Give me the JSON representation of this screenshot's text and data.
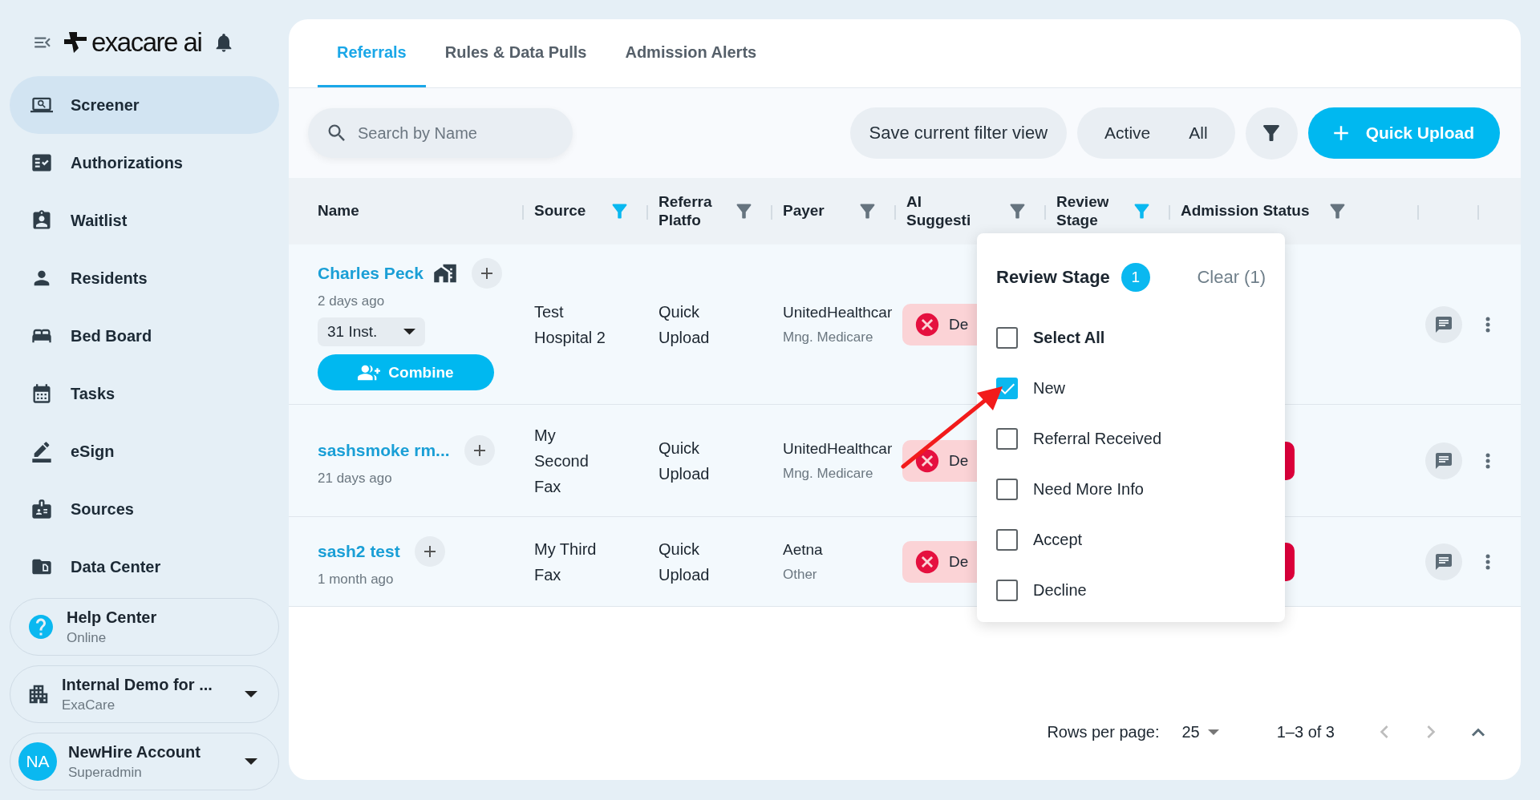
{
  "sidebar": {
    "brand": "exacare ai",
    "items": [
      {
        "label": "Screener",
        "selected": true
      },
      {
        "label": "Authorizations",
        "selected": false
      },
      {
        "label": "Waitlist",
        "selected": false
      },
      {
        "label": "Residents",
        "selected": false
      },
      {
        "label": "Bed Board",
        "selected": false
      },
      {
        "label": "Tasks",
        "selected": false
      },
      {
        "label": "eSign",
        "selected": false
      },
      {
        "label": "Sources",
        "selected": false
      },
      {
        "label": "Data Center",
        "selected": false
      }
    ],
    "help": {
      "title": "Help Center",
      "status": "Online"
    },
    "org": {
      "name": "Internal Demo for ...",
      "sub": "ExaCare"
    },
    "user": {
      "initials": "NA",
      "name": "NewHire Account",
      "role": "Superadmin"
    }
  },
  "tabs": [
    {
      "label": "Referrals",
      "selected": true
    },
    {
      "label": "Rules & Data Pulls",
      "selected": false
    },
    {
      "label": "Admission Alerts",
      "selected": false
    }
  ],
  "toolbar": {
    "search": {
      "placeholder": "Search by Name"
    },
    "save_view": "Save current filter view",
    "views": [
      "Active",
      "All"
    ],
    "quick_upload": "Quick Upload"
  },
  "table": {
    "columns": [
      {
        "label": "Name"
      },
      {
        "label": "Source",
        "filtered": true
      },
      {
        "label": "Referra\nPlatfo",
        "filtered": false
      },
      {
        "label": "Payer",
        "filtered": false
      },
      {
        "label": "AI\nSuggesti",
        "filtered": false
      },
      {
        "label": "Review\nStage",
        "filtered": true
      },
      {
        "label": "Admission Status",
        "filtered": false
      }
    ],
    "rows": [
      {
        "name": "Charles Peck",
        "house": true,
        "time": "2 days ago",
        "instances": "31 Inst.",
        "combine": "Combine",
        "source": "Test Hospital 2",
        "platform": "Quick Upload",
        "payer": "UnitedHealthcar",
        "payer_type": "Mng. Medicare",
        "ai_suggestion": "De",
        "admission_badge": false
      },
      {
        "name": "sashsmoke rm...",
        "house": false,
        "time": "21 days ago",
        "source": "My Second Fax",
        "platform": "Quick Upload",
        "payer": "UnitedHealthcar",
        "payer_type": "Mng. Medicare",
        "ai_suggestion": "De",
        "admission_badge": true
      },
      {
        "name": "sash2 test",
        "house": false,
        "time": "1 month ago",
        "source": "My Third Fax",
        "platform": "Quick Upload",
        "payer": "Aetna",
        "payer_type": "Other",
        "ai_suggestion": "De",
        "admission_badge": true
      }
    ]
  },
  "review_stage_filter": {
    "title": "Review Stage",
    "count": "1",
    "clear": "Clear (1)",
    "options": [
      {
        "label": "Select All",
        "checked": false,
        "kind": "all"
      },
      {
        "label": "New",
        "checked": true,
        "kind": "option"
      },
      {
        "label": "Referral Received",
        "checked": false,
        "kind": "option"
      },
      {
        "label": "Need More Info",
        "checked": false,
        "kind": "option"
      },
      {
        "label": "Accept",
        "checked": false,
        "kind": "option"
      },
      {
        "label": "Decline",
        "checked": false,
        "kind": "option"
      }
    ]
  },
  "pagination": {
    "rows_label": "Rows per page:",
    "rows_value": "25",
    "range": "1–3 of 3"
  }
}
